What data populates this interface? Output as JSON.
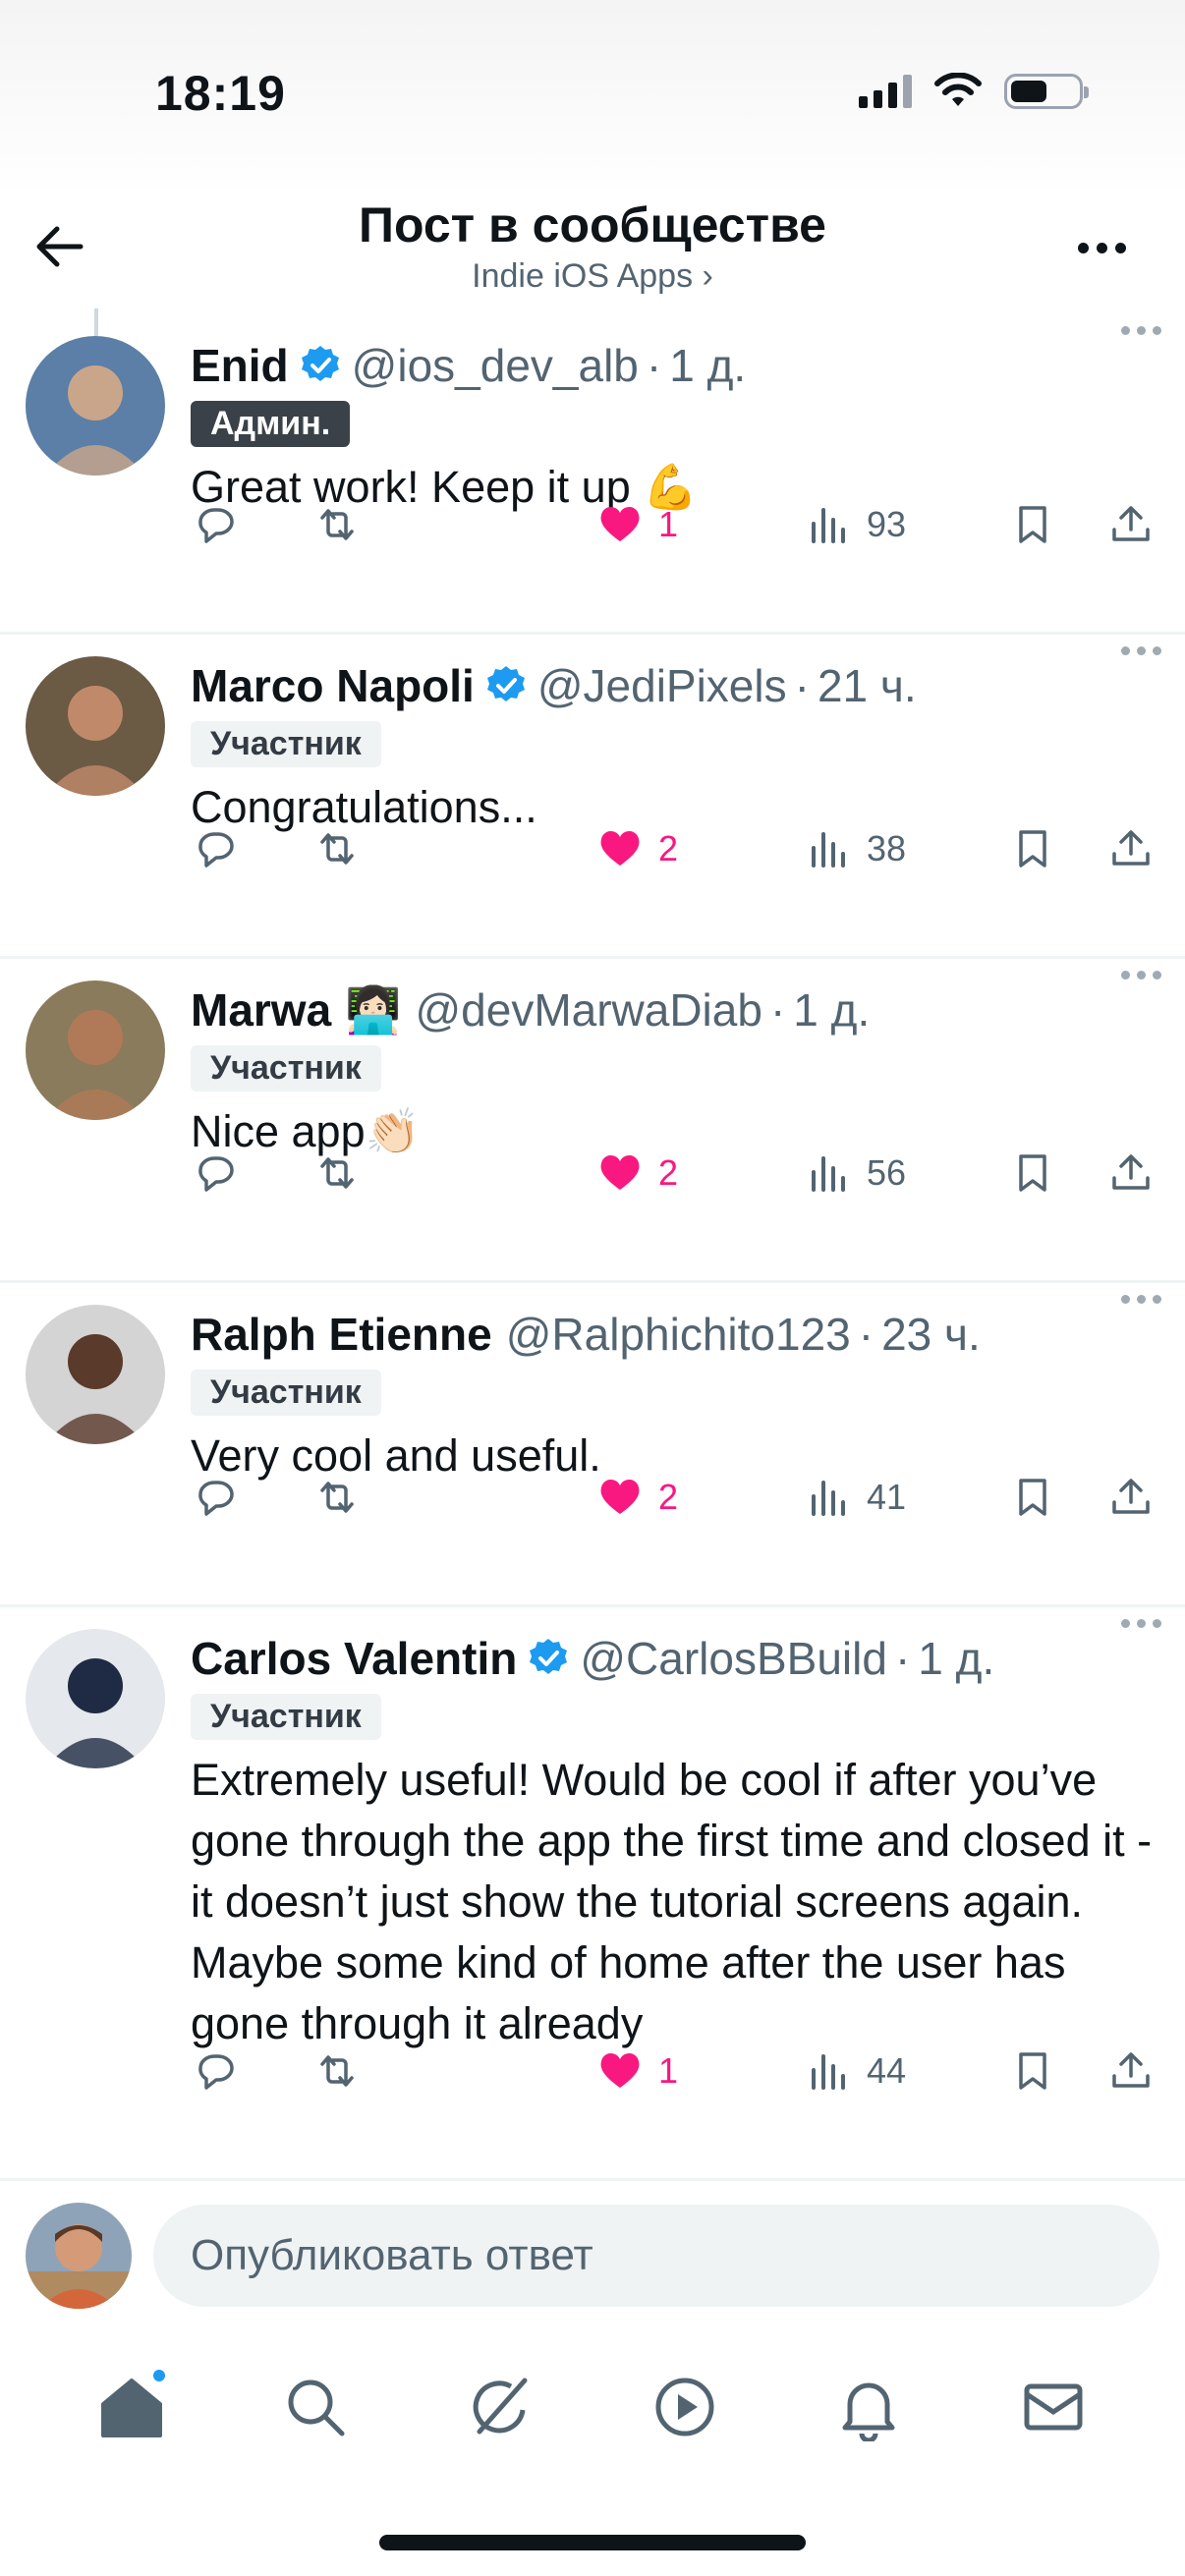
{
  "status_bar": {
    "time": "18:19",
    "battery_level": 0.55
  },
  "header": {
    "title": "Пост в сообществе",
    "subtitle": "Indie iOS Apps ›"
  },
  "posts": [
    {
      "name": "Enid",
      "verified": true,
      "name_emoji": "",
      "handle": "@ios_dev_alb",
      "age": "1 д.",
      "role": "Админ.",
      "text": "Great work! Keep it up 💪",
      "likes": "1",
      "views": "93",
      "avatar_colors": [
        "#5b7fa6",
        "#c9a68a"
      ]
    },
    {
      "name": "Marco Napoli",
      "verified": true,
      "name_emoji": "",
      "handle": "@JediPixels",
      "age": "21 ч.",
      "role": "Участник",
      "text": "Congratulations...",
      "likes": "2",
      "views": "38",
      "avatar_colors": [
        "#6b5a44",
        "#c08a6a"
      ]
    },
    {
      "name": "Marwa",
      "verified": false,
      "name_emoji": "👩🏻‍💻",
      "handle": "@devMarwaDiab",
      "age": "1 д.",
      "role": "Участник",
      "text": "Nice app👏🏻",
      "likes": "2",
      "views": "56",
      "avatar_colors": [
        "#8a7b5c",
        "#b07a58"
      ]
    },
    {
      "name": "Ralph Etienne",
      "verified": false,
      "name_emoji": "",
      "handle": "@Ralphichito123",
      "age": "23 ч.",
      "role": "Участник",
      "text": "Very cool and useful.",
      "likes": "2",
      "views": "41",
      "avatar_colors": [
        "#d4d4d4",
        "#5a3a2a"
      ]
    },
    {
      "name": "Carlos Valentin",
      "verified": true,
      "name_emoji": "",
      "handle": "@CarlosBBuild",
      "age": "1 д.",
      "role": "Участник",
      "text": "Extremely useful! Would be cool if after you’ve gone through the app the first time and closed it - it doesn’t just show the tutorial screens again. Maybe some kind of home after the user has gone through it already",
      "likes": "1",
      "views": "44",
      "avatar_colors": [
        "#e5e8ec",
        "#1f2a44"
      ]
    }
  ],
  "reply": {
    "placeholder": "Опубликовать ответ"
  },
  "icons": {
    "back": "arrow-left-icon",
    "more": "more-horizontal-icon",
    "verified": "verified-badge-icon",
    "reply": "reply-icon",
    "repost": "repost-icon",
    "like": "heart-icon",
    "views": "views-icon",
    "bookmark": "bookmark-icon",
    "share": "share-icon"
  },
  "tabs": [
    "home-icon",
    "search-icon",
    "grok-icon",
    "video-icon",
    "notifications-icon",
    "messages-icon"
  ],
  "colors": {
    "like": "#f91880",
    "verified": "#1d9bf0",
    "text": "#0f1419",
    "muted": "#536471"
  }
}
